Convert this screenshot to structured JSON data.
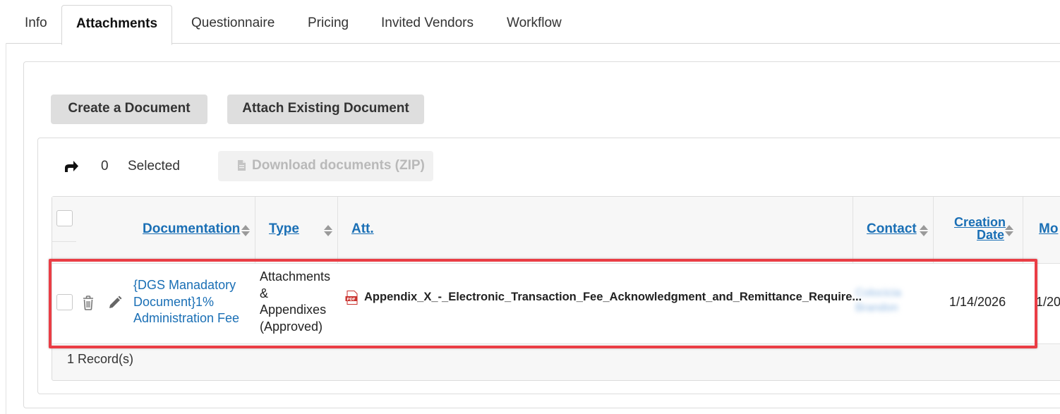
{
  "tabs": [
    {
      "label": "Info"
    },
    {
      "label": "Attachments"
    },
    {
      "label": "Questionnaire"
    },
    {
      "label": "Pricing"
    },
    {
      "label": "Invited Vendors"
    },
    {
      "label": "Workflow"
    }
  ],
  "active_tab": "Attachments",
  "toolbar": {
    "create_label": "Create a Document",
    "attach_label": "Attach Existing Document"
  },
  "selection": {
    "count": "0",
    "label": "Selected",
    "download_label": "Download documents (ZIP)"
  },
  "table": {
    "columns": {
      "documentation": "Documentation",
      "type": "Type",
      "att": "Att.",
      "contact": "Contact",
      "creation_line1": "Creation",
      "creation_line2": "Date",
      "modified": "Mo"
    },
    "row": {
      "doc_line1": "{DGS Manadatory",
      "doc_line2": "Document}1%",
      "doc_line3": "Administration Fee",
      "type_line1": "Attachments",
      "type_line2": "&",
      "type_line3": "Appendixes",
      "type_line4": "(Approved)",
      "attachment": "Appendix_X_-_Electronic_Transaction_Fee_Acknowledgment_and_Remittance_Require...",
      "contact_line1": "Colocicia",
      "contact_line2": "Brandon",
      "creation_date": "1/14/2026",
      "modified_date": "1/20"
    },
    "records": "1 Record(s)"
  },
  "colors": {
    "link": "#1a6fb5",
    "highlight": "#ea3d45",
    "button_bg": "#dedede"
  },
  "icons": [
    "share-arrow-icon",
    "file-icon",
    "trash-icon",
    "pencil-icon",
    "pdf-icon",
    "sort-icon"
  ]
}
